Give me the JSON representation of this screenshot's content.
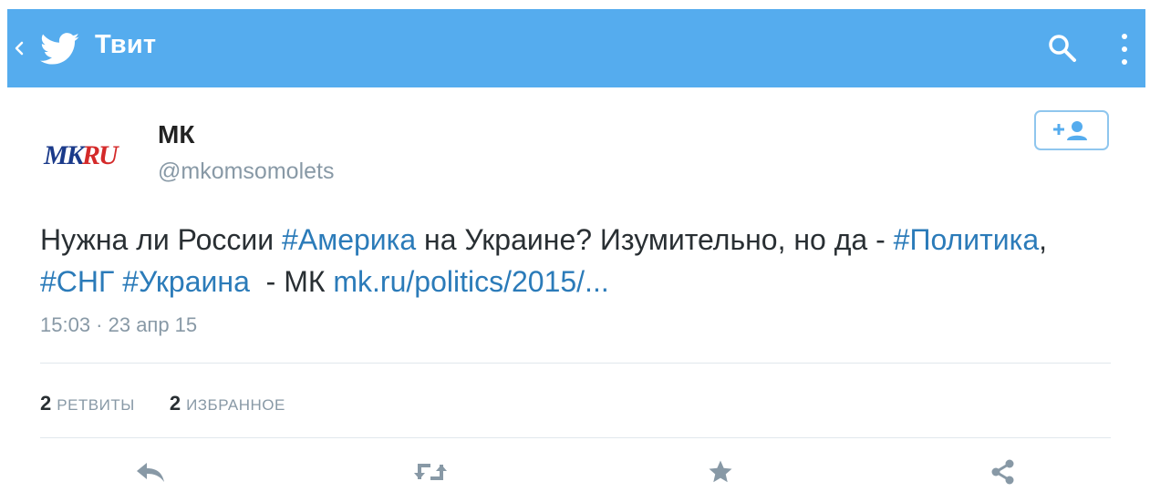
{
  "header": {
    "title": "Твит",
    "bar_color": "#55acee",
    "back_icon": "chevron-left-icon",
    "logo_icon": "twitter-bird-icon",
    "search_icon": "search-icon",
    "menu_icon": "more-vertical-icon"
  },
  "author": {
    "avatar_text": "MKRU",
    "name": "МК",
    "handle": "@mkomsomolets",
    "follow_icon": "add-user-icon"
  },
  "tweet": {
    "text_1": "Нужна ли России ",
    "tag_1": "#Америка",
    "text_2": " на Украине? Изумительно, но да - ",
    "tag_2": "#Политика",
    "text_3": ",",
    "tag_3": "#СНГ",
    "text_4": " ",
    "tag_4": "#Украина",
    "text_5": "  - МК ",
    "link": "mk.ru/politics/2015/...",
    "timestamp": "15:03 · 23 апр 15",
    "link_color": "#2b7bb9"
  },
  "stats": {
    "retweets_count": "2",
    "retweets_label": "РЕТВИТЫ",
    "favorites_count": "2",
    "favorites_label": "ИЗБРАННОЕ"
  },
  "actions": {
    "reply_icon": "reply-icon",
    "retweet_icon": "retweet-icon",
    "favorite_icon": "star-icon",
    "share_icon": "share-icon",
    "icon_color": "#8899a6"
  }
}
